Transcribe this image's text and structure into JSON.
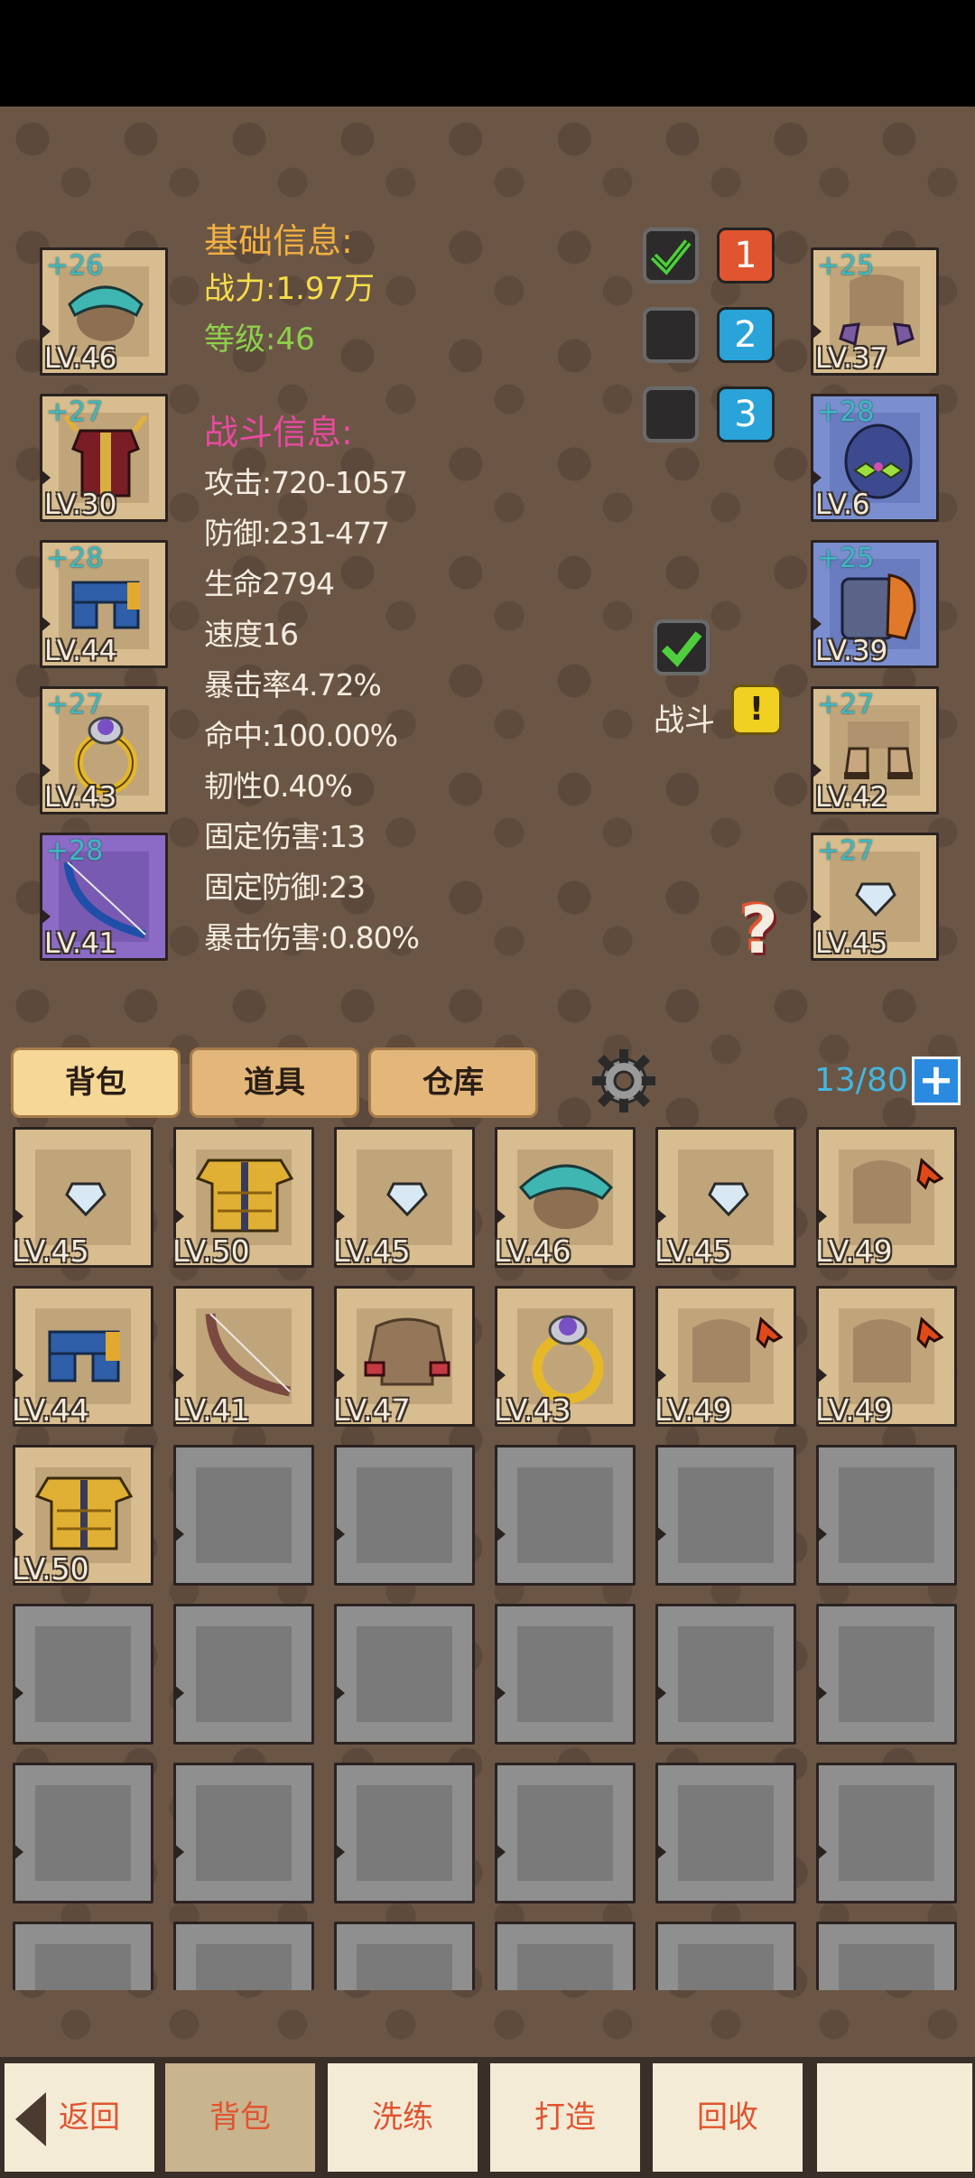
{
  "basic_info": {
    "title": "基础信息:",
    "power": "战力:1.97万",
    "level": "等级:46"
  },
  "combat_info": {
    "title": "战斗信息:",
    "stats": [
      "攻击:720-1057",
      "防御:231-477",
      "生命2794",
      "速度16",
      "暴击率4.72%",
      "命中:100.00%",
      "韧性0.40%",
      "固定伤害:13",
      "固定防御:23",
      "暴击伤害:0.80%"
    ]
  },
  "left_equipment": [
    {
      "plus": "+26",
      "level": "LV.46",
      "icon": "helmet-icon"
    },
    {
      "plus": "+27",
      "level": "LV.30",
      "icon": "armor-icon"
    },
    {
      "plus": "+28",
      "level": "LV.44",
      "icon": "pants-icon"
    },
    {
      "plus": "+27",
      "level": "LV.43",
      "icon": "ring-icon"
    },
    {
      "plus": "+28",
      "level": "LV.41",
      "icon": "bow-icon"
    }
  ],
  "right_equipment": [
    {
      "plus": "+25",
      "level": "LV.37",
      "icon": "gloves-icon"
    },
    {
      "plus": "+28",
      "level": "LV.6",
      "icon": "necklace-icon"
    },
    {
      "plus": "+25",
      "level": "LV.39",
      "icon": "backpack-icon"
    },
    {
      "plus": "+27",
      "level": "LV.42",
      "icon": "boots-icon"
    },
    {
      "plus": "+27",
      "level": "LV.45",
      "icon": "gem-icon"
    }
  ],
  "preset_buttons": [
    "1",
    "2",
    "3"
  ],
  "battle": {
    "label": "战斗",
    "alert": "!"
  },
  "help": "?",
  "tabs": [
    "背包",
    "道具",
    "仓库"
  ],
  "capacity": "13/80",
  "capacity_add": "+",
  "inventory": [
    {
      "level": "LV.45",
      "icon": "gem-icon"
    },
    {
      "level": "LV.50",
      "icon": "gold-armor-icon"
    },
    {
      "level": "LV.45",
      "icon": "gem-icon"
    },
    {
      "level": "LV.46",
      "icon": "helmet-icon"
    },
    {
      "level": "LV.45",
      "icon": "gem-icon"
    },
    {
      "level": "LV.49",
      "icon": "wing-armor-icon"
    },
    {
      "level": "LV.44",
      "icon": "pants-icon"
    },
    {
      "level": "LV.41",
      "icon": "bow-icon"
    },
    {
      "level": "LV.47",
      "icon": "shirt-icon"
    },
    {
      "level": "LV.43",
      "icon": "ring-icon"
    },
    {
      "level": "LV.49",
      "icon": "wing-armor-icon"
    },
    {
      "level": "LV.49",
      "icon": "wing-armor-icon"
    },
    {
      "level": "LV.50",
      "icon": "gold-armor-icon"
    }
  ],
  "bottom_nav": {
    "back": "返回",
    "items": [
      "背包",
      "洗练",
      "打造",
      "回收",
      ""
    ]
  },
  "colors": {
    "background": "#6b5646",
    "slot": "#d7bd8f",
    "slot_purple": "#8b6bc6",
    "slot_blue": "#7b8fd0",
    "basic_title": "#f1b040",
    "combat_title": "#e84aa0",
    "power_text": "#f7dc4a",
    "level_text": "#8ed04a",
    "plus_text": "#3fb8c0",
    "capacity_text": "#43b6e0"
  }
}
